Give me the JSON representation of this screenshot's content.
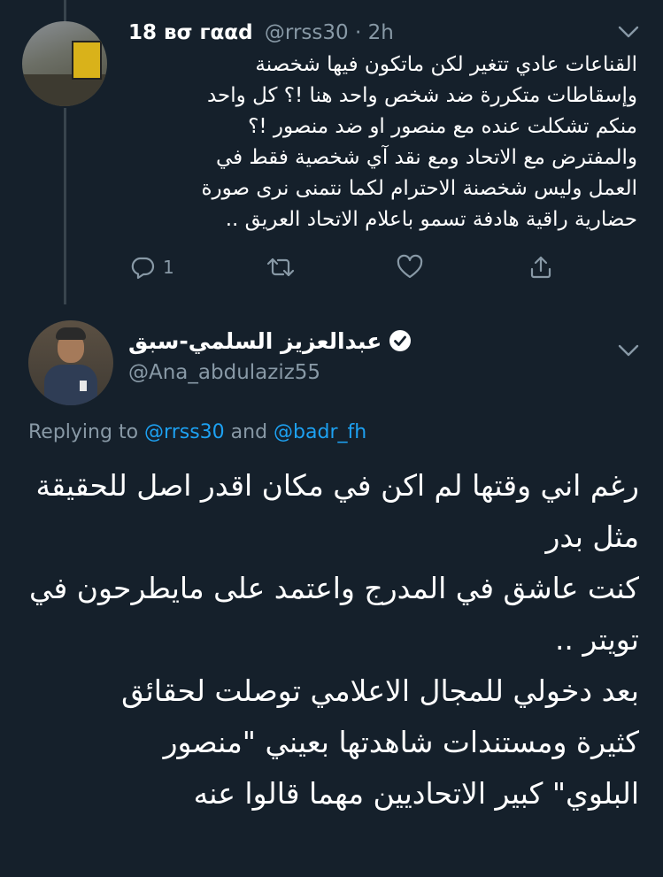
{
  "tweet1": {
    "name": "18 вσ гααd",
    "handle": "@rrss30 · 2h",
    "lines": [
      "القناعات عادي تتغير لكن ماتكون فيها شخصنة",
      "وإسقاطات متكررة ضد شخص واحد هنا !؟ كل واحد",
      "منكم تشكلت عنده مع منصور او ضد منصور !؟",
      "والمفترض مع الاتحاد ومع نقد آي شخصية فقط في",
      "العمل وليس شخصنة الاحترام لكما نتمنى نرى صورة",
      "حضارية راقية هادفة تسمو باعلام الاتحاد العريق .."
    ],
    "reply_count": "1"
  },
  "tweet2": {
    "name": "عبدالعزيز السلمي-سبق",
    "handle": "@Ana_abdulaziz55",
    "replying_prefix": "Replying to ",
    "replying_user1": "@rrss30",
    "replying_and": " and ",
    "replying_user2": "@badr_fh",
    "lines": [
      "رغم اني وقتها لم اكن في مكان اقدر اصل للحقيقة",
      "مثل بدر",
      "كنت عاشق في المدرج واعتمد على مايطرحون في",
      "تويتر ..",
      "بعد دخولي للمجال الاعلامي توصلت لحقائق",
      "كثيرة ومستندات شاهدتها بعيني \"منصور",
      "البلوي\" كبير الاتحاديين مهما قالوا عنه"
    ]
  },
  "colors": {
    "background": "#15202b",
    "secondary_text": "#8899a6",
    "link": "#1da1f2",
    "thread_line": "#38444d"
  },
  "icons": [
    "chevron-down-icon",
    "reply-icon",
    "retweet-icon",
    "like-icon",
    "share-icon",
    "verified-icon"
  ]
}
